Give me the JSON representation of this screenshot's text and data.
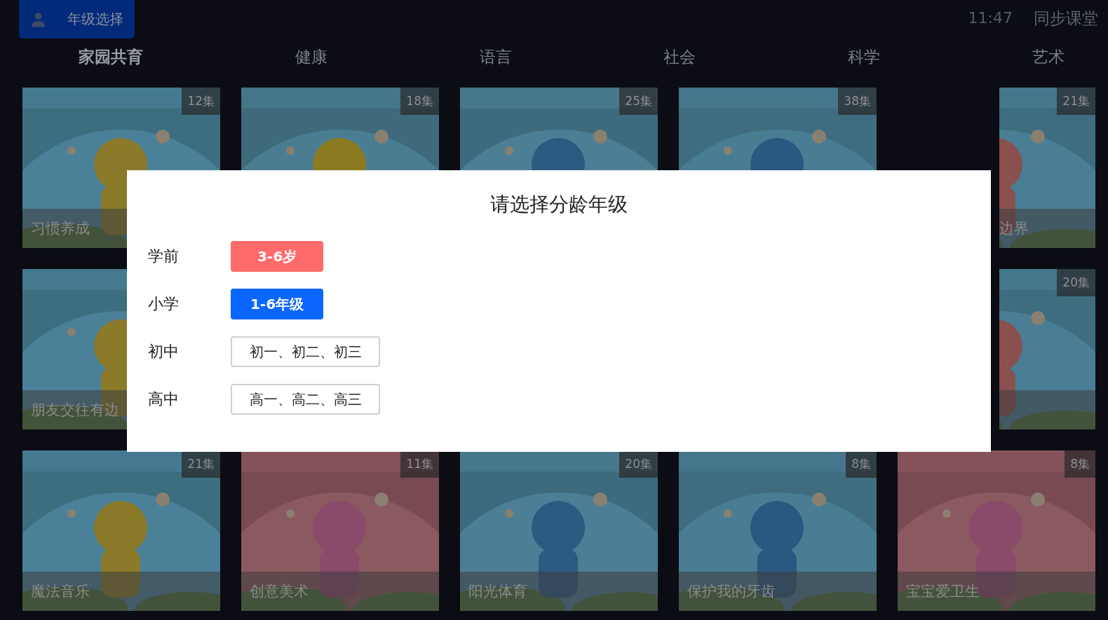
{
  "top_bar": {
    "grade_button": "年级选择",
    "time": "11:47",
    "app_title": "同步课堂"
  },
  "tabs": [
    {
      "label": "家园共育",
      "selected": true
    },
    {
      "label": "健康",
      "selected": false
    },
    {
      "label": "语言",
      "selected": false
    },
    {
      "label": "社会",
      "selected": false
    },
    {
      "label": "科学",
      "selected": false
    },
    {
      "label": "艺术",
      "selected": false
    }
  ],
  "cards": [
    {
      "kind": "full",
      "badge": "12集",
      "caption": "习惯养成"
    },
    {
      "kind": "top_part",
      "badge": "18集"
    },
    {
      "kind": "top_part",
      "badge": "25集"
    },
    {
      "kind": "top_part",
      "badge": "38集"
    },
    {
      "kind": "right_part",
      "badge": "21集",
      "caption": "边界"
    },
    {
      "kind": "left_part",
      "caption": "朋友交往有边"
    },
    {
      "kind": "covered"
    },
    {
      "kind": "covered"
    },
    {
      "kind": "covered"
    },
    {
      "kind": "right_part",
      "badge": "20集"
    },
    {
      "kind": "full",
      "badge": "21集",
      "caption": "魔法音乐"
    },
    {
      "kind": "full",
      "badge": "11集",
      "caption": "创意美术"
    },
    {
      "kind": "full",
      "badge": "20集",
      "caption": "阳光体育"
    },
    {
      "kind": "full",
      "badge": "8集",
      "caption": "保护我的牙齿"
    },
    {
      "kind": "full",
      "badge": "8集",
      "caption": "宝宝爱卫生"
    }
  ],
  "dialog": {
    "title": "请选择分龄年级",
    "rows": [
      {
        "label": "学前",
        "option": "3-6岁",
        "kind": "filled",
        "color": "#ff6b6b"
      },
      {
        "label": "小学",
        "option": "1-6年级",
        "kind": "filled",
        "color": "#0a66ff"
      },
      {
        "label": "初中",
        "option": "初一、初二、初三",
        "kind": "outline"
      },
      {
        "label": "高中",
        "option": "高一、高二、高三",
        "kind": "outline"
      }
    ]
  }
}
